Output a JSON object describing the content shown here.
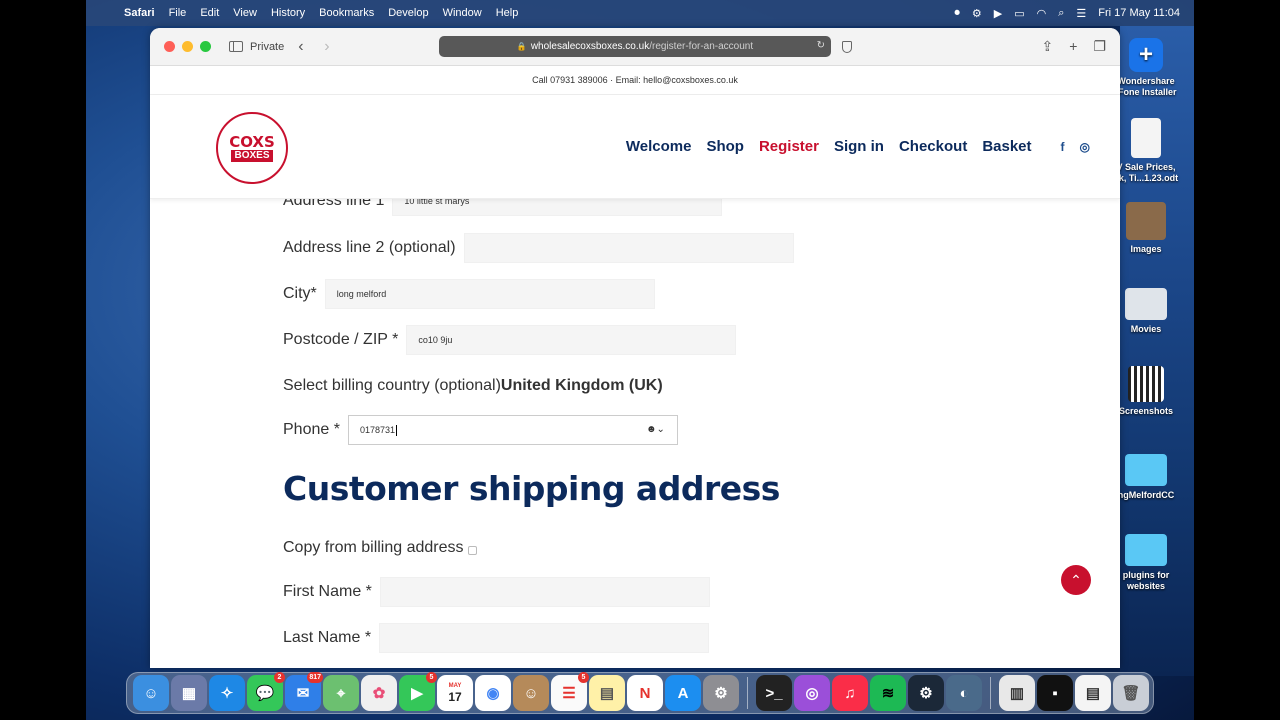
{
  "menubar": {
    "app_name": "Safari",
    "items": [
      "File",
      "Edit",
      "View",
      "History",
      "Bookmarks",
      "Develop",
      "Window",
      "Help"
    ],
    "datetime": "Fri 17 May  11:04"
  },
  "browser": {
    "private_label": "Private",
    "url_domain": "wholesalecoxsboxes.co.uk",
    "url_path": "/register-for-an-account"
  },
  "site": {
    "topinfo": "Call 07931 389006 · Email: hello@coxsboxes.co.uk",
    "logo_line1": "COXS",
    "logo_line2": "BOXES",
    "nav": [
      "Welcome",
      "Shop",
      "Register",
      "Sign in",
      "Checkout",
      "Basket"
    ],
    "active_nav": "Register",
    "social": [
      "f",
      "ig"
    ]
  },
  "form": {
    "address1_label": "Address line 1",
    "address1_value": "10 little st marys",
    "address2_label": "Address line 2 (optional)",
    "address2_value": "",
    "city_label": "City*",
    "city_value": "long melford",
    "postcode_label": "Postcode / ZIP *",
    "postcode_value": "co10 9ju",
    "country_label": "Select billing country (optional)",
    "country_value": "United Kingdom (UK)",
    "phone_label": "Phone *",
    "phone_value": "0178731",
    "shipping_title": "Customer shipping address",
    "copy_label": "Copy from billing address",
    "first_name_label": "First Name *",
    "last_name_label": "Last Name *"
  },
  "desktop_icons": [
    {
      "label": "Wondershare .Fone Installer"
    },
    {
      "label": "V Sale Prices, ck, Ti...1.23.odt"
    },
    {
      "label": "Images"
    },
    {
      "label": "Movies"
    },
    {
      "label": "Screenshots"
    },
    {
      "label": "ngMelfordCC"
    },
    {
      "label": "plugins for websites"
    }
  ],
  "dock": {
    "badges": {
      "messages": "2",
      "mail": "817",
      "facetime": "5",
      "reminders": "5"
    },
    "calendar_month": "MAY",
    "calendar_day": "17"
  }
}
